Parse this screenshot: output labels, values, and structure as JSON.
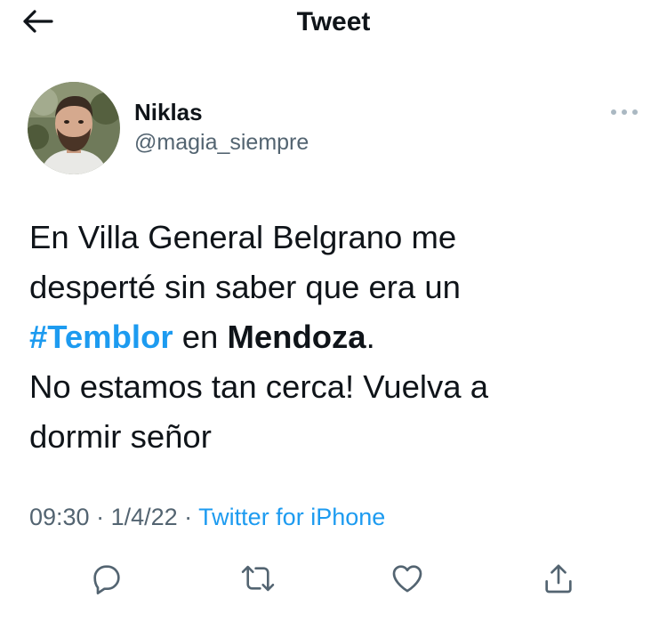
{
  "header": {
    "title": "Tweet"
  },
  "tweet": {
    "author": {
      "display_name": "Niklas",
      "handle": "@magia_siempre"
    },
    "text": {
      "line1": "En Villa General Belgrano me",
      "line2": "desperté sin saber que era un",
      "hashtag": "#Temblor",
      "mid": " en ",
      "mention_place": "Mendoza",
      "period": ".",
      "line4": "No estamos tan cerca! Vuelva a",
      "line5": "dormir señor"
    },
    "time": "09:30",
    "date": "1/4/22",
    "separator": " · ",
    "source": "Twitter for iPhone"
  },
  "icons": {
    "back": "arrow-left-icon",
    "more": "more-horizontal-icon",
    "reply": "reply-icon",
    "retweet": "retweet-icon",
    "like": "heart-icon",
    "share": "share-icon"
  },
  "colors": {
    "accent": "#1d9bf0",
    "text": "#0f1419",
    "secondary": "#536471"
  }
}
